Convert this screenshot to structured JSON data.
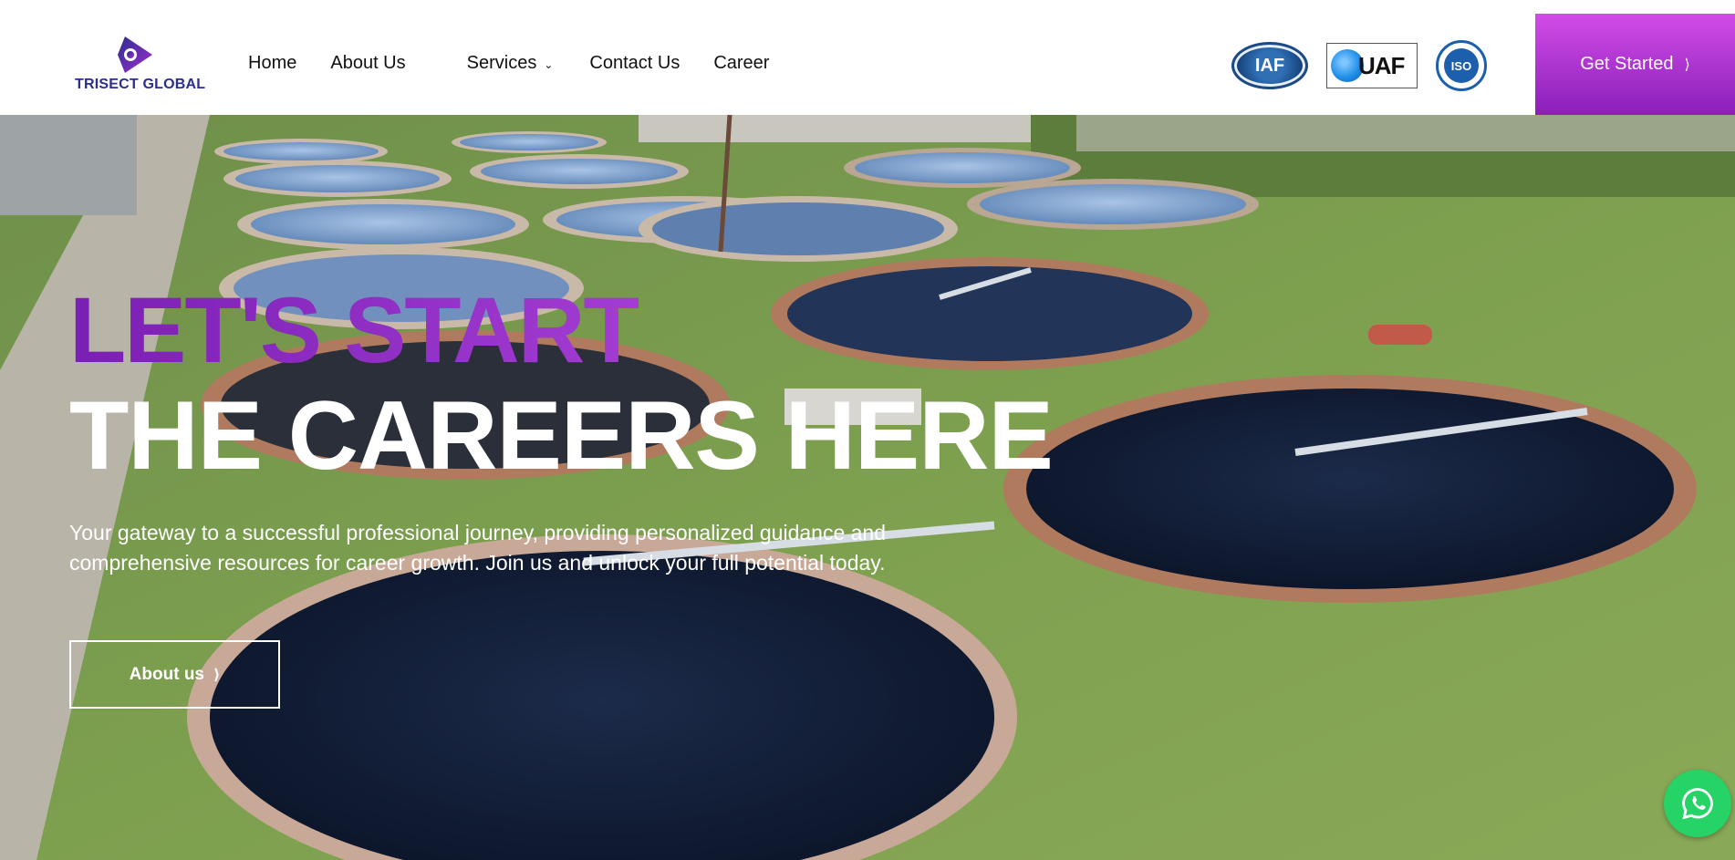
{
  "brand": {
    "name": "TRISECT GLOBAL",
    "color": "#2b2e8f",
    "accent": "#8a22c0"
  },
  "nav": {
    "items": [
      {
        "label": "Home"
      },
      {
        "label": "About Us"
      },
      {
        "label": "Services"
      },
      {
        "label": "Contact Us"
      },
      {
        "label": "Career"
      }
    ]
  },
  "certifications": {
    "iaf": "IAF",
    "uaf": "UAF",
    "iso": "ISO"
  },
  "cta": {
    "label": "Get Started"
  },
  "hero": {
    "headline_line1": "LET'S START",
    "headline_line2": "THE CAREERS HERE",
    "description": "Your gateway to a successful professional journey, providing personalized guidance and comprehensive resources for career growth. Join us and unlock your full potential today.",
    "button_label": "About us"
  },
  "icons": {
    "whatsapp": "whatsapp-icon",
    "chevron_right": "chevron-right-icon",
    "chevron_down": "chevron-down-icon"
  }
}
